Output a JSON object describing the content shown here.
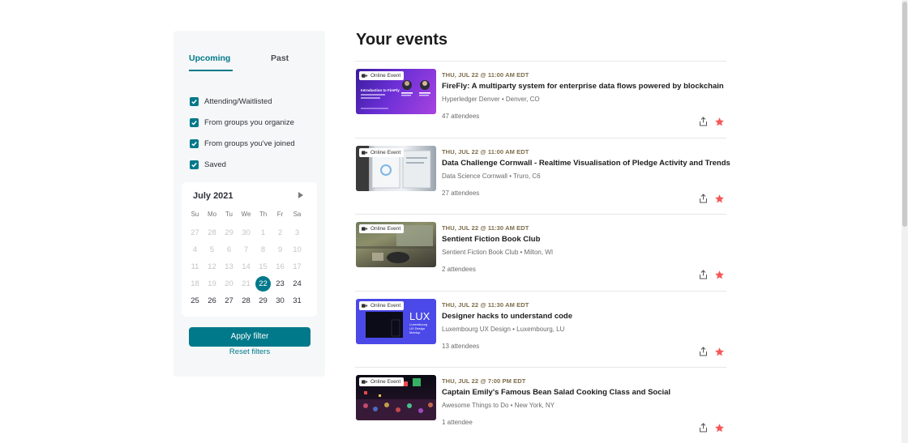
{
  "page": {
    "title": "Your events"
  },
  "sidebar": {
    "tabs": [
      {
        "label": "Upcoming",
        "active": true
      },
      {
        "label": "Past",
        "active": false
      }
    ],
    "filters": [
      {
        "label": "Attending/Waitlisted",
        "checked": true
      },
      {
        "label": "From groups you organize",
        "checked": true
      },
      {
        "label": "From groups you've joined",
        "checked": true
      },
      {
        "label": "Saved",
        "checked": true
      }
    ],
    "calendar": {
      "month_label": "July 2021",
      "weekdays": [
        "Su",
        "Mo",
        "Tu",
        "We",
        "Th",
        "Fr",
        "Sa"
      ],
      "days": [
        "27",
        "28",
        "29",
        "30",
        "1",
        "2",
        "3",
        "4",
        "5",
        "6",
        "7",
        "8",
        "9",
        "10",
        "11",
        "12",
        "13",
        "14",
        "15",
        "16",
        "17",
        "18",
        "19",
        "20",
        "21",
        "22",
        "23",
        "24",
        "25",
        "26",
        "27",
        "28",
        "29",
        "30",
        "31"
      ],
      "selected_day": "22"
    },
    "apply_label": "Apply filter",
    "reset_label": "Reset filters"
  },
  "badge_label": "Online Event",
  "events": [
    {
      "date": "THU, JUL 22 @ 11:00 AM EDT",
      "title": "FireFly: A multiparty system for enterprise data flows powered by blockchain",
      "group": "Hyperledger Denver • Denver, CO",
      "attendees": "47 attendees",
      "saved": true
    },
    {
      "date": "THU, JUL 22 @ 11:00 AM EDT",
      "title": "Data Challenge Cornwall - Realtime Visualisation of Pledge Activity and Trends",
      "group": "Data Science Cornwall • Truro, C6",
      "attendees": "27 attendees",
      "saved": true
    },
    {
      "date": "THU, JUL 22 @ 11:30 AM EDT",
      "title": "Sentient Fiction Book Club",
      "group": "Sentient Fiction Book Club • Milton, WI",
      "attendees": "2 attendees",
      "saved": true
    },
    {
      "date": "THU, JUL 22 @ 11:30 AM EDT",
      "title": "Designer hacks to understand code",
      "group": "Luxembourg UX Design • Luxembourg, LU",
      "attendees": "13 attendees",
      "saved": true
    },
    {
      "date": "THU, JUL 22 @ 7:00 PM EDT",
      "title": "Captain Emily's Famous Bean Salad Cooking Class and Social",
      "group": "Awesome Things to Do • New York, NY",
      "attendees": "1 attendee",
      "saved": true
    }
  ],
  "thumb_art": {
    "firefly_title": "Introduction to FireFly",
    "lux_label": "LUX",
    "lux_sub": "Luxembourg UX Design Meetup"
  },
  "colors": {
    "accent": "#00798a",
    "star": "#f65858",
    "date": "#7d6c4a"
  }
}
